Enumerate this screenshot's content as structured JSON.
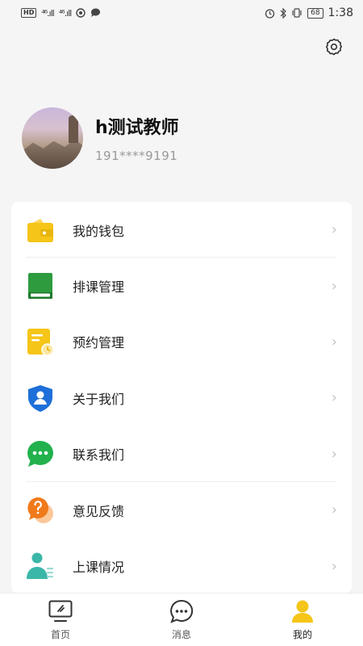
{
  "status_bar": {
    "left_chip": "HD",
    "signal1": "⁴⁶.ıll",
    "signal2": "⁴⁶.ıll",
    "battery": "68",
    "time": "1:38"
  },
  "profile": {
    "name": "h测试教师",
    "phone": "191****9191"
  },
  "menu": {
    "items": [
      {
        "label": "我的钱包",
        "icon": "wallet-icon",
        "color": "#F5C518"
      },
      {
        "label": "排课管理",
        "icon": "book-icon",
        "color": "#2E9B3E"
      },
      {
        "label": "预约管理",
        "icon": "appointment-icon",
        "color": "#F5C518"
      },
      {
        "label": "关于我们",
        "icon": "shield-user-icon",
        "color": "#1E6FD9"
      },
      {
        "label": "联系我们",
        "icon": "chat-icon",
        "color": "#22B14C"
      },
      {
        "label": "意见反馈",
        "icon": "feedback-icon",
        "color": "#F07A1A"
      },
      {
        "label": "上课情况",
        "icon": "class-status-icon",
        "color": "#3BB7A8"
      }
    ]
  },
  "tabs": [
    {
      "label": "首页",
      "icon": "monitor-icon"
    },
    {
      "label": "消息",
      "icon": "message-icon"
    },
    {
      "label": "我的",
      "icon": "person-icon",
      "active": true
    }
  ],
  "colors": {
    "accent": "#F5C518",
    "background": "#F5F5F5"
  }
}
